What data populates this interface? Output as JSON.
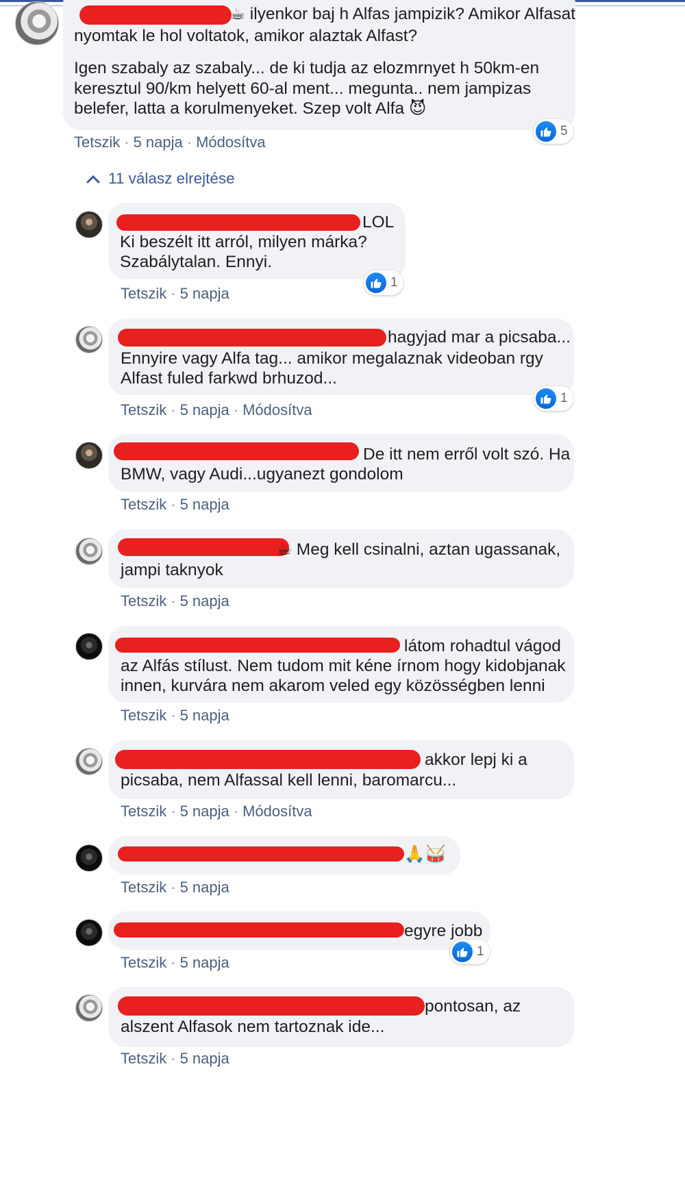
{
  "colors": {
    "bubble_bg": "#f0f2f5",
    "link": "#4b5f7f",
    "like_blue": "#1877f2",
    "redaction": "#e8201f"
  },
  "main_comment": {
    "line1": "ilyenkor baj h Alfas jampizik? Amikor Alfasat",
    "line2": "nyomtak le hol voltatok, amikor alaztak Alfast?",
    "line3": "Igen szabaly az szabaly... de ki tudja az elozmrnyet h 50km-en",
    "line4": "keresztul 90/km helyett 60-al ment... megunta.. nem jampizas",
    "line5": "belefer, latta a korulmenyeket. Szep volt Alfa",
    "emoji_prefix": "☕",
    "emoji_suffix": "😈",
    "like_label": "Tetszik",
    "time": "5 napja",
    "edited": "Módosítva",
    "reaction_count": "5"
  },
  "replies_toggle": {
    "label": "11 válasz elrejtése"
  },
  "replies": [
    {
      "lines": [
        "LOL",
        "Ki beszélt itt arról, milyen márka?",
        "Szabálytalan. Ennyi."
      ],
      "like_label": "Tetszik",
      "time": "5 napja",
      "edited": "",
      "reaction_count": "1"
    },
    {
      "lines": [
        "hagyjad mar a picsaba...",
        "Ennyire vagy Alfa tag... amikor megalaznak videoban rgy",
        "Alfast fuled farkwd brhuzod..."
      ],
      "like_label": "Tetszik",
      "time": "5 napja",
      "edited": "Módosítva",
      "reaction_count": "1"
    },
    {
      "lines": [
        "De itt nem erről volt szó. Ha",
        "BMW, vagy Audi...ugyanezt gondolom"
      ],
      "like_label": "Tetszik",
      "time": "5 napja",
      "edited": "",
      "reaction_count": ""
    },
    {
      "lines": [
        "Meg kell csinalni, aztan ugassanak,",
        "jampi taknyok"
      ],
      "emoji_prefix": "☕",
      "like_label": "Tetszik",
      "time": "5 napja",
      "edited": "",
      "reaction_count": ""
    },
    {
      "lines": [
        "látom rohadtul vágod",
        "az Alfás stílust. Nem tudom mit kéne írnom hogy kidobjanak",
        "innen, kurvára nem akarom veled egy közösségben lenni"
      ],
      "like_label": "Tetszik",
      "time": "5 napja",
      "edited": "",
      "reaction_count": ""
    },
    {
      "lines": [
        "akkor lepj ki a",
        "picsaba, nem Alfassal kell lenni, baromarcu..."
      ],
      "like_label": "Tetszik",
      "time": "5 napja",
      "edited": "Módosítva",
      "reaction_count": ""
    },
    {
      "lines": [
        "🙏🥁"
      ],
      "like_label": "Tetszik",
      "time": "5 napja",
      "edited": "",
      "reaction_count": ""
    },
    {
      "lines": [
        "egyre jobb"
      ],
      "like_label": "Tetszik",
      "time": "5 napja",
      "edited": "",
      "reaction_count": "1"
    },
    {
      "lines": [
        "pontosan, az",
        "alszent Alfasok nem tartoznak ide..."
      ],
      "like_label": "Tetszik",
      "time": "5 napja",
      "edited": "",
      "reaction_count": ""
    }
  ]
}
